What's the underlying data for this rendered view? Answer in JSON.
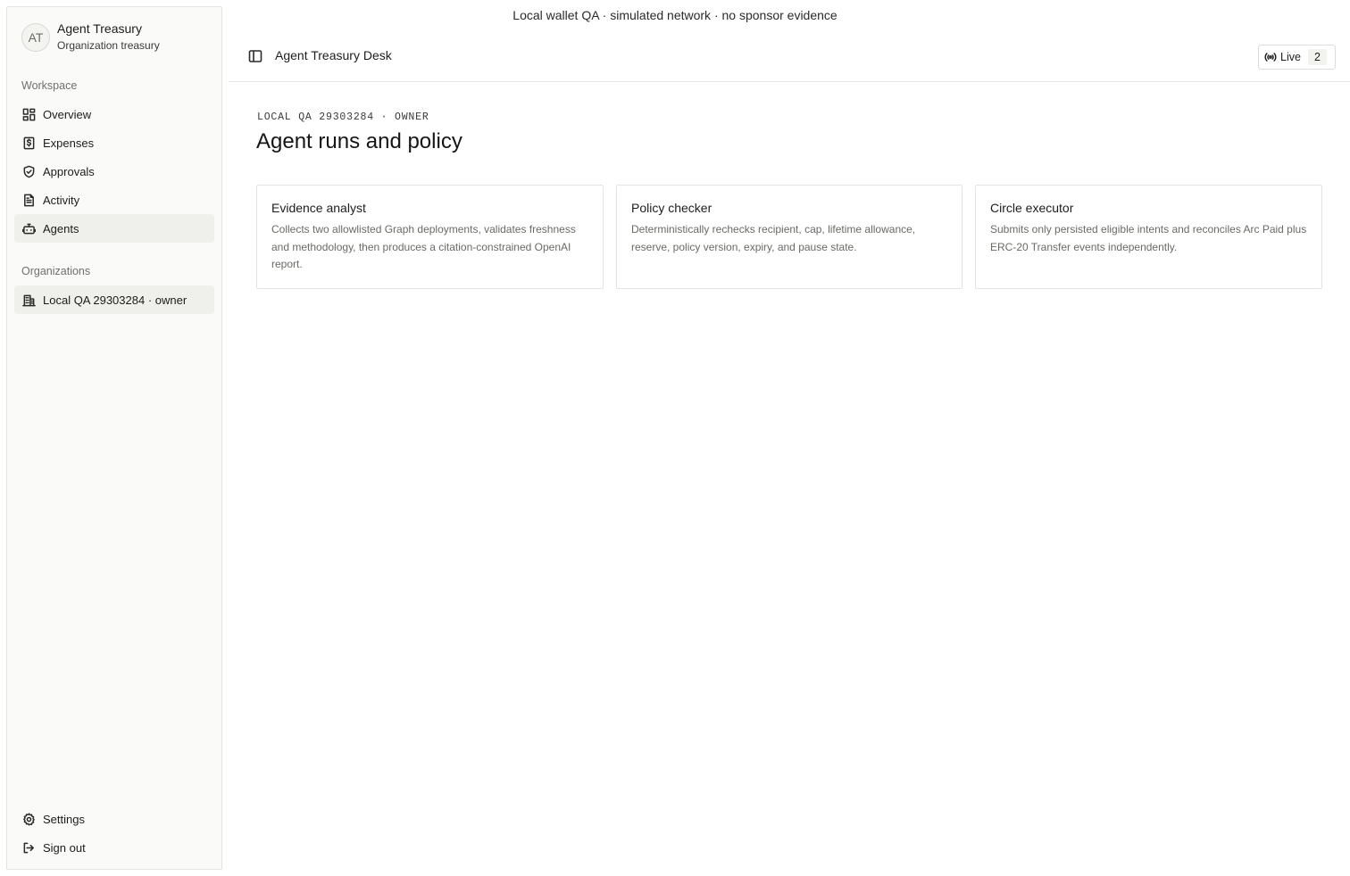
{
  "banner": "Local wallet QA · simulated network · no sponsor evidence",
  "brand": {
    "initials": "AT",
    "name": "Agent Treasury",
    "subtitle": "Organization treasury"
  },
  "sidebar": {
    "workspace_label": "Workspace",
    "items": [
      {
        "label": "Overview",
        "icon": "dashboard-icon"
      },
      {
        "label": "Expenses",
        "icon": "dollar-receipt-icon"
      },
      {
        "label": "Approvals",
        "icon": "shield-check-icon"
      },
      {
        "label": "Activity",
        "icon": "document-icon"
      },
      {
        "label": "Agents",
        "icon": "bot-icon",
        "active": true
      }
    ],
    "organizations_label": "Organizations",
    "org_item": {
      "label": "Local QA 29303284 · owner",
      "icon": "building-icon"
    },
    "settings": "Settings",
    "signout": "Sign out"
  },
  "topbar": {
    "title": "Agent Treasury Desk",
    "live_label": "Live",
    "live_count": "2"
  },
  "main": {
    "eyebrow": "LOCAL QA 29303284 · OWNER",
    "title": "Agent runs and policy",
    "cards": [
      {
        "title": "Evidence analyst",
        "body": "Collects two allowlisted Graph deployments, validates freshness and methodology, then produces a citation-constrained OpenAI report."
      },
      {
        "title": "Policy checker",
        "body": "Deterministically rechecks recipient, cap, lifetime allowance, reserve, policy version, expiry, and pause state."
      },
      {
        "title": "Circle executor",
        "body": "Submits only persisted eligible intents and reconciles Arc Paid plus ERC-20 Transfer events independently."
      }
    ]
  }
}
